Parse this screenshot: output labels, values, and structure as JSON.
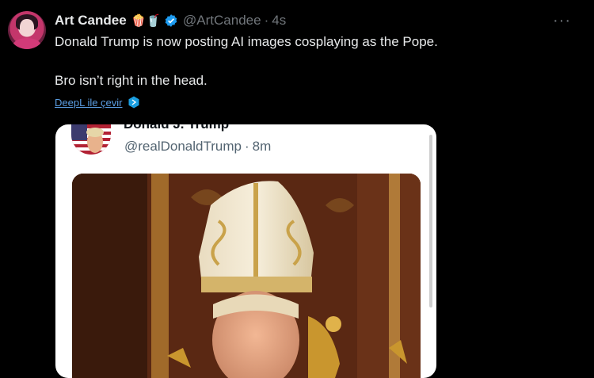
{
  "tweet": {
    "author_name": "Art Candee",
    "emojis": "🍿🥤",
    "handle": "@ArtCandee",
    "separator": "·",
    "time": "4s",
    "more": "···",
    "text_line1": "Donald Trump is now posting AI images cosplaying as the Pope.",
    "text_line2": "Bro isn’t right in the head.",
    "translate_label": "DeepL ile çevir"
  },
  "quoted": {
    "name_clipped": "Donald J. Trump",
    "handle": "@realDonaldTrump",
    "separator": "·",
    "time": "8m"
  },
  "colors": {
    "background": "#000000",
    "text": "#e7e9ea",
    "muted": "#71767b",
    "link": "#5b9ee3",
    "verified": "#1d9bf0",
    "card_bg": "#ffffff"
  },
  "icons": [
    "verified-badge-icon",
    "more-options-icon",
    "deepl-icon"
  ]
}
